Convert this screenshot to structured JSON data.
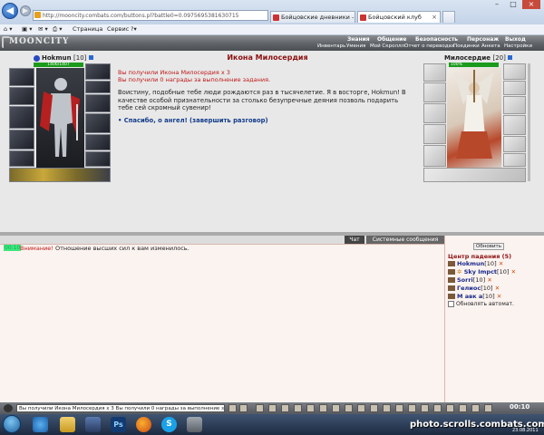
{
  "browser": {
    "url": "http://mooncity.combats.com/buttons.pl?battle0=0.0975695381630715",
    "tabs": [
      {
        "label": "Бойцовские дневники - (iter..."
      },
      {
        "label": "Бойцовский клуб"
      }
    ],
    "toolbar": {
      "page": "Страница",
      "service": "Сервис"
    }
  },
  "game": {
    "logo": "MOONCITY",
    "nav_top": [
      "Знания",
      "Общение",
      "Безопасность",
      "Персонаж",
      "Выход"
    ],
    "nav_sub": [
      "Инвентарь",
      "Умения",
      "Мой Скроллл",
      "Отчет о переводах",
      "Поединки",
      "Анкета",
      "Настройки"
    ]
  },
  "hero": {
    "name": "Hokmun",
    "level": "[10]",
    "hp": "1406/1407"
  },
  "bot": {
    "name": "Милосердие",
    "level": "[20]",
    "hp": "100%"
  },
  "dialog": {
    "title": "Икона Милосердия",
    "msg1": "Вы получили Икона Милосердия х 3",
    "msg2": "Вы получили 0 награды за выполнение задания.",
    "body": "Воистину, подобные тебе люди рождаются раз в тысячелетие. Я в восторге, Hokmun! В качестве особой признательности за столько безупречные деяния позволь подарить тебе сей скромный сувенир!",
    "link": "• Спасибо, о ангел! (завершить разговор)"
  },
  "chat": {
    "tabs": [
      "Чат",
      "Системные сообщения"
    ],
    "time": "00:10",
    "warn": "Внимание!",
    "message": "Отношение высших сил к вам изменилось."
  },
  "online": {
    "refresh": "Обновить",
    "room": "Центр падения (5)",
    "users": [
      {
        "name": "Hokmun",
        "level": "[10]"
      },
      {
        "name": "Sky Impct",
        "level": "[10]"
      },
      {
        "name": "Sorri",
        "level": "[10]"
      },
      {
        "name": "Гелиос",
        "level": "[10]"
      },
      {
        "name": "М авк а",
        "level": "[10]"
      }
    ],
    "auto": "Обновлять автомат."
  },
  "input": {
    "value": "Вы получили Икона Милосердия х 3 Вы получили 0 награды за выполнение задания.",
    "clock": "00:10"
  },
  "watermark": {
    "text": "photo.scrolls.combats.com",
    "date": "23.08.2011"
  }
}
